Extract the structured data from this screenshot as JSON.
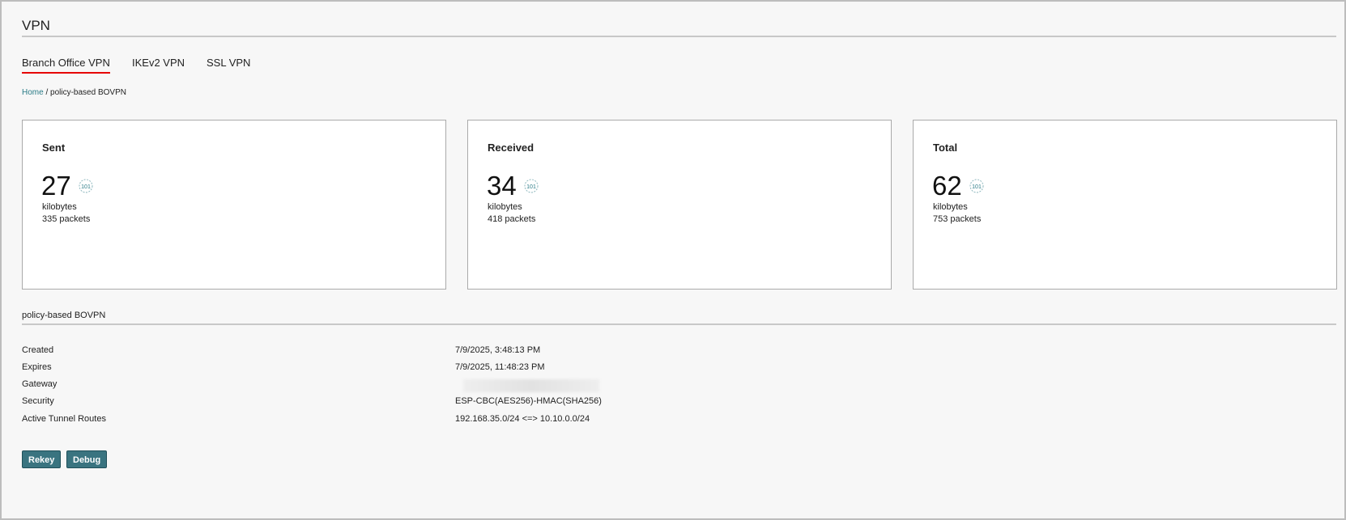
{
  "page": {
    "title": "VPN"
  },
  "tabs": [
    {
      "label": "Branch Office VPN",
      "active": true
    },
    {
      "label": "IKEv2 VPN"
    },
    {
      "label": "SSL VPN"
    }
  ],
  "breadcrumb": {
    "home": "Home",
    "separator": " / ",
    "current": "policy-based BOVPN"
  },
  "cards": [
    {
      "label": "Sent",
      "value": "27",
      "unit": "kilobytes",
      "packets": "335 packets",
      "icon": "binary-data-icon"
    },
    {
      "label": "Received",
      "value": "34",
      "unit": "kilobytes",
      "packets": "418 packets",
      "icon": "binary-data-icon"
    },
    {
      "label": "Total",
      "value": "62",
      "unit": "kilobytes",
      "packets": "753 packets",
      "icon": "binary-data-icon"
    }
  ],
  "details": {
    "heading": "policy-based BOVPN",
    "rows": [
      {
        "label": "Created",
        "value": "7/9/2025, 3:48:13 PM"
      },
      {
        "label": "Expires",
        "value": "7/9/2025, 11:48:23 PM"
      },
      {
        "label": "Gateway",
        "value": ""
      },
      {
        "label": "Security",
        "value": "ESP-CBC(AES256)-HMAC(SHA256)"
      },
      {
        "label": "Active Tunnel Routes",
        "value": "192.168.35.0/24 <=> 10.10.0.0/24"
      }
    ]
  },
  "buttons": {
    "rekey": "Rekey",
    "debug": "Debug"
  },
  "colors": {
    "accent": "#3a7480",
    "tab_underline": "#e60000",
    "link": "#2a7b86"
  }
}
